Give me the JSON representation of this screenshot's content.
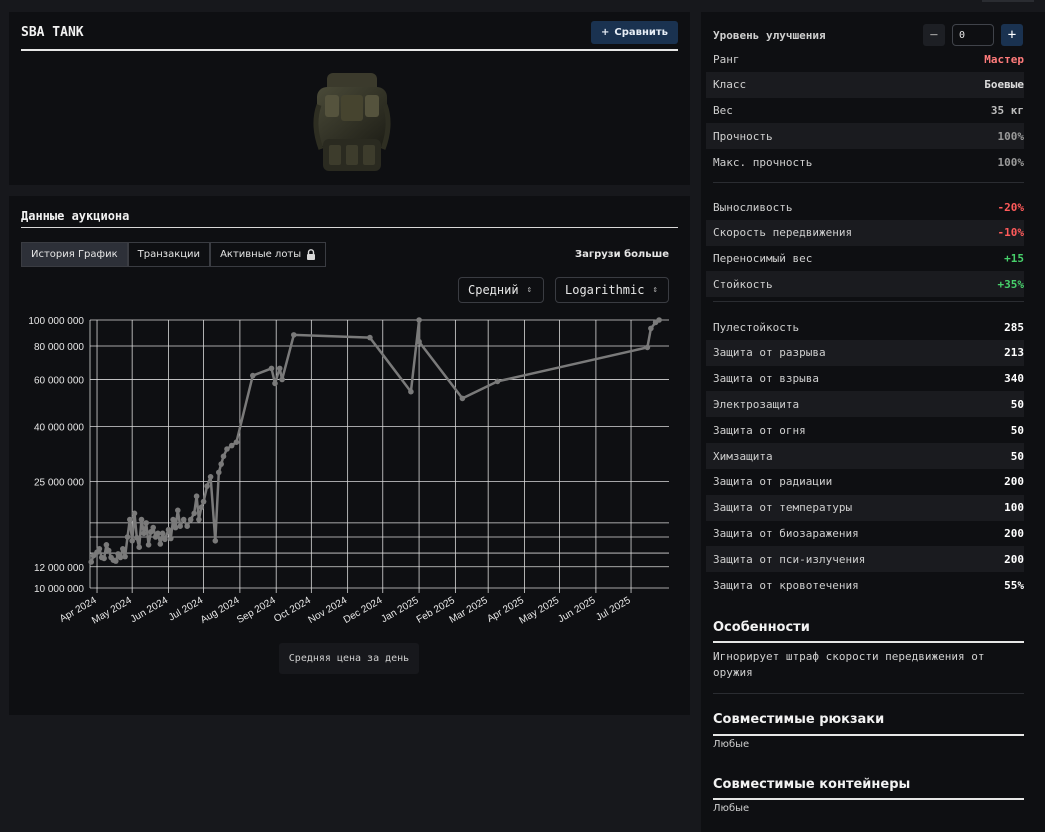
{
  "item": {
    "title": "SBA TANK",
    "compare_label": "Сравнить"
  },
  "auction": {
    "title": "Данные аукциона",
    "tabs": [
      {
        "label": "История График",
        "active": true
      },
      {
        "label": "Транзакции",
        "active": false
      },
      {
        "label": "Активные лоты",
        "active": false,
        "locked": true
      }
    ],
    "load_more": "Загрузи больше",
    "price_mode": "Средний",
    "scale_mode": "Logarithmic",
    "caption": "Средняя цена за день"
  },
  "chart_data": {
    "type": "line",
    "scale": "log",
    "ylim": [
      10000000,
      100000000
    ],
    "y_ticks": [
      10000000,
      12000000,
      25000000,
      40000000,
      60000000,
      80000000,
      100000000
    ],
    "y_tick_labels": [
      "10 000 000",
      "12 000 000",
      "25 000 000",
      "40 000 000",
      "60 000 000",
      "80 000 000",
      "100 000 000"
    ],
    "y_extra_gridlines": [
      13500000,
      15500000,
      17500000
    ],
    "x_ticks": [
      "2024-04-01",
      "2024-05-01",
      "2024-06-01",
      "2024-07-01",
      "2024-08-01",
      "2024-09-01",
      "2024-10-01",
      "2024-11-01",
      "2024-12-01",
      "2025-01-01",
      "2025-02-01",
      "2025-03-01",
      "2025-04-01",
      "2025-05-01",
      "2025-06-01",
      "2025-07-01"
    ],
    "x_tick_labels": [
      "Apr 2024",
      "May 2024",
      "Jun 2024",
      "Jul 2024",
      "Aug 2024",
      "Sep 2024",
      "Oct 2024",
      "Nov 2024",
      "Dec 2024",
      "Jan 2025",
      "Feb 2025",
      "Mar 2025",
      "Apr 2025",
      "May 2025",
      "Jun 2025",
      "Jul 2025"
    ],
    "xlim": [
      "2024-03-26",
      "2025-07-30"
    ],
    "grid": true,
    "color": "#7a7a7a",
    "points": [
      [
        "2024-03-27",
        12500000
      ],
      [
        "2024-03-29",
        13200000
      ],
      [
        "2024-04-01",
        13600000
      ],
      [
        "2024-04-03",
        14000000
      ],
      [
        "2024-04-05",
        13000000
      ],
      [
        "2024-04-07",
        12900000
      ],
      [
        "2024-04-09",
        14500000
      ],
      [
        "2024-04-11",
        13800000
      ],
      [
        "2024-04-13",
        13000000
      ],
      [
        "2024-04-15",
        12700000
      ],
      [
        "2024-04-17",
        12600000
      ],
      [
        "2024-04-19",
        13400000
      ],
      [
        "2024-04-21",
        13000000
      ],
      [
        "2024-04-23",
        14000000
      ],
      [
        "2024-04-25",
        13100000
      ],
      [
        "2024-04-27",
        15500000
      ],
      [
        "2024-04-29",
        18000000
      ],
      [
        "2024-05-01",
        15000000
      ],
      [
        "2024-05-03",
        19000000
      ],
      [
        "2024-05-05",
        15400000
      ],
      [
        "2024-05-07",
        14200000
      ],
      [
        "2024-05-09",
        18000000
      ],
      [
        "2024-05-11",
        16000000
      ],
      [
        "2024-05-13",
        17500000
      ],
      [
        "2024-05-15",
        14500000
      ],
      [
        "2024-05-17",
        16200000
      ],
      [
        "2024-05-19",
        16800000
      ],
      [
        "2024-05-21",
        15500000
      ],
      [
        "2024-05-23",
        16000000
      ],
      [
        "2024-05-25",
        14600000
      ],
      [
        "2024-05-27",
        16000000
      ],
      [
        "2024-05-29",
        15200000
      ],
      [
        "2024-06-01",
        16500000
      ],
      [
        "2024-06-03",
        15300000
      ],
      [
        "2024-06-05",
        18000000
      ],
      [
        "2024-06-07",
        16800000
      ],
      [
        "2024-06-09",
        19500000
      ],
      [
        "2024-06-11",
        17000000
      ],
      [
        "2024-06-14",
        18000000
      ],
      [
        "2024-06-17",
        17000000
      ],
      [
        "2024-06-20",
        18000000
      ],
      [
        "2024-06-23",
        19000000
      ],
      [
        "2024-06-25",
        22000000
      ],
      [
        "2024-06-27",
        18000000
      ],
      [
        "2024-06-29",
        20000000
      ],
      [
        "2024-07-01",
        21000000
      ],
      [
        "2024-07-04",
        24000000
      ],
      [
        "2024-07-07",
        26000000
      ],
      [
        "2024-07-11",
        15000000
      ],
      [
        "2024-07-14",
        27000000
      ],
      [
        "2024-07-16",
        29000000
      ],
      [
        "2024-07-18",
        31000000
      ],
      [
        "2024-07-21",
        33000000
      ],
      [
        "2024-07-25",
        34000000
      ],
      [
        "2024-07-29",
        35000000
      ],
      [
        "2024-08-12",
        62000000
      ],
      [
        "2024-08-28",
        66000000
      ],
      [
        "2024-08-31",
        58000000
      ],
      [
        "2024-09-04",
        66000000
      ],
      [
        "2024-09-06",
        60000000
      ],
      [
        "2024-09-16",
        88000000
      ],
      [
        "2024-11-20",
        86000000
      ],
      [
        "2024-12-25",
        54000000
      ],
      [
        "2025-01-01",
        100000000
      ],
      [
        "2025-01-01",
        83000000
      ],
      [
        "2025-02-07",
        51000000
      ],
      [
        "2025-03-09",
        59000000
      ],
      [
        "2025-07-15",
        79000000
      ],
      [
        "2025-07-18",
        93000000
      ],
      [
        "2025-07-22",
        98000000
      ],
      [
        "2025-07-25",
        100000000
      ]
    ]
  },
  "upgrade": {
    "label": "Уровень улучшения",
    "value": "0"
  },
  "stats_group1": [
    {
      "label": "Ранг",
      "value": "Мастер",
      "color": "#ff7b7b"
    },
    {
      "label": "Класс",
      "value": "Боевые",
      "color": "#dcdcdc"
    },
    {
      "label": "Вес",
      "value": "35 кг",
      "color": "#bdbdbd"
    },
    {
      "label": "Прочность",
      "value": "100%",
      "color": "#9a9a9a"
    },
    {
      "label": "Макс. прочность",
      "value": "100%",
      "color": "#9a9a9a"
    }
  ],
  "stats_group2": [
    {
      "label": "Выносливость",
      "value": "-20%",
      "color": "#ff5a5a"
    },
    {
      "label": "Скорость передвижения",
      "value": "-10%",
      "color": "#ff5a5a"
    },
    {
      "label": "Переносимый вес",
      "value": "+15",
      "color": "#47d16b"
    },
    {
      "label": "Стойкость",
      "value": "+35%",
      "color": "#47d16b"
    }
  ],
  "stats_group3": [
    {
      "label": "Пулестойкость",
      "value": "285",
      "color": "#ffffff"
    },
    {
      "label": "Защита от разрыва",
      "value": "213",
      "color": "#ffffff"
    },
    {
      "label": "Защита от взрыва",
      "value": "340",
      "color": "#ffffff"
    },
    {
      "label": "Электрозащита",
      "value": "50",
      "color": "#ffffff"
    },
    {
      "label": "Защита от огня",
      "value": "50",
      "color": "#ffffff"
    },
    {
      "label": "Химзащита",
      "value": "50",
      "color": "#ffffff"
    },
    {
      "label": "Защита от радиации",
      "value": "200",
      "color": "#ffffff"
    },
    {
      "label": "Защита от температуры",
      "value": "100",
      "color": "#ffffff"
    },
    {
      "label": "Защита от биозаражения",
      "value": "200",
      "color": "#ffffff"
    },
    {
      "label": "Защита от пси-излучения",
      "value": "200",
      "color": "#ffffff"
    },
    {
      "label": "Защита от кровотечения",
      "value": "55%",
      "color": "#ffffff"
    }
  ],
  "features": {
    "title": "Особенности",
    "text": "Игнорирует штраф скорости передвижения от оружия"
  },
  "backpacks": {
    "title": "Совместимые рюкзаки",
    "value": "Любые"
  },
  "containers": {
    "title": "Совместимые контейнеры",
    "value": "Любые"
  }
}
